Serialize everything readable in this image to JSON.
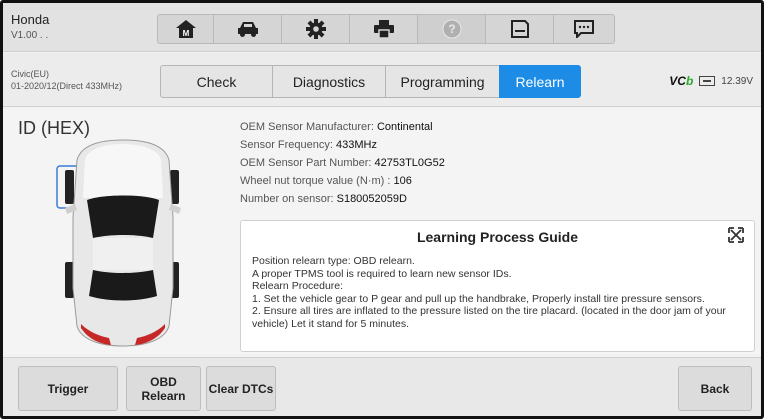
{
  "header": {
    "make": "Honda",
    "version": "V1.00 . ."
  },
  "toolbar": {
    "icons": [
      "home-icon",
      "vehicle-icon",
      "settings-icon",
      "print-icon",
      "help-icon",
      "save-icon",
      "feedback-icon"
    ]
  },
  "vehicle_bar": {
    "model": "Civic(EU)",
    "range": "01-2020/12(Direct 433MHz)"
  },
  "tabs": [
    {
      "label": "Check",
      "active": false
    },
    {
      "label": "Diagnostics",
      "active": false
    },
    {
      "label": "Programming",
      "active": false
    },
    {
      "label": "Relearn",
      "active": true
    }
  ],
  "status": {
    "vci_prefix": "VC",
    "vci_suffix": "I",
    "voltage": "12.39V"
  },
  "main": {
    "id_label": "ID (HEX)",
    "info": [
      {
        "label": "OEM Sensor Manufacturer: ",
        "value": "Continental"
      },
      {
        "label": "Sensor Frequency: ",
        "value": "433MHz"
      },
      {
        "label": "OEM Sensor Part Number:   ",
        "value": "42753TL0G52"
      },
      {
        "label": "Wheel nut torque value (N·m) :   ",
        "value": "106"
      },
      {
        "label": "Number on sensor:   ",
        "value": "S180052059D"
      }
    ]
  },
  "guide": {
    "title": "Learning Process Guide",
    "lines": [
      "Position relearn type: OBD relearn.",
      "A proper TPMS tool is required to learn new sensor IDs.",
      "Relearn Procedure:",
      "1. Set the vehicle gear to P gear and pull up the handbrake, Properly install tire pressure sensors.",
      "2. Ensure all tires are inflated to the pressure listed on the tire placard. (located in the door jam of your vehicle) Let it stand for 5 minutes."
    ]
  },
  "buttons": {
    "trigger": "Trigger",
    "obd_relearn_1": "OBD",
    "obd_relearn_2": "Relearn",
    "clear_dtcs": "Clear DTCs",
    "back": "Back"
  },
  "colors": {
    "accent": "#1c8ce6",
    "selected_sensor": "#3a7bd5"
  }
}
